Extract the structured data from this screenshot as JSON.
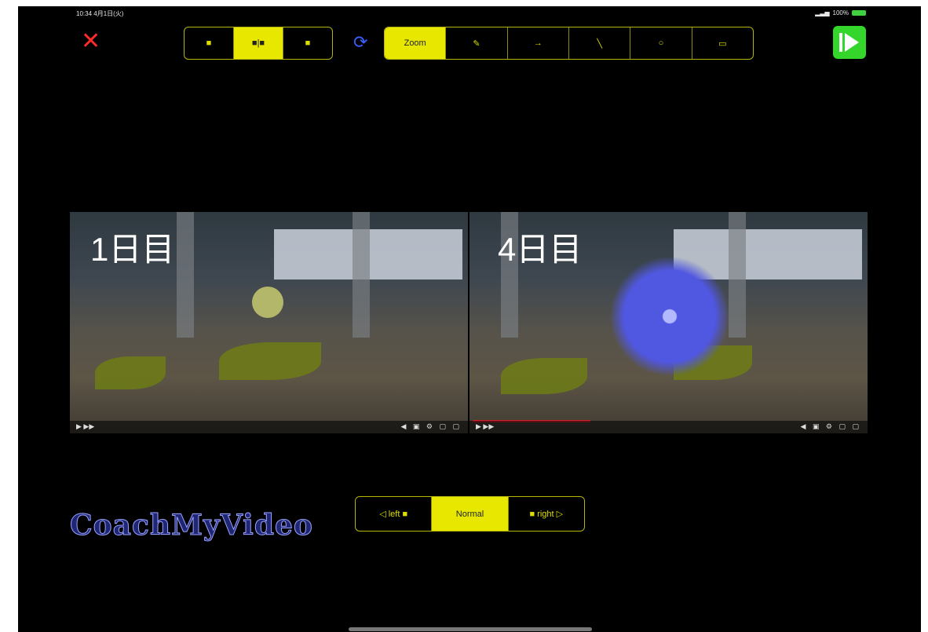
{
  "status": {
    "time": "10:34 4月1日(火)",
    "battery": "100%"
  },
  "toolbar": {
    "view_modes": [
      {
        "label": "■",
        "active": false
      },
      {
        "label": "■|■",
        "active": true
      },
      {
        "label": "■",
        "active": false
      }
    ],
    "tools": [
      {
        "label": "Zoom",
        "active": true
      },
      {
        "label": "✎",
        "active": false
      },
      {
        "label": "→",
        "active": false
      },
      {
        "label": "╲",
        "active": false
      },
      {
        "label": "○",
        "active": false
      },
      {
        "label": "▭",
        "active": false
      }
    ]
  },
  "videos": [
    {
      "label": "1日目"
    },
    {
      "label": "4日目"
    }
  ],
  "sync_controls": [
    {
      "label": "◁ left ■",
      "active": false
    },
    {
      "label": "Normal",
      "active": true
    },
    {
      "label": "■ right ▷",
      "active": false
    }
  ],
  "logo": {
    "text": "CoachMyVideo"
  },
  "colors": {
    "accent": "#e7e700",
    "close": "#ff2a2a",
    "play": "#34d62c",
    "background": "#000000"
  },
  "icons": {
    "close": "close-icon",
    "refresh": "refresh-icon",
    "play": "play-icon"
  }
}
